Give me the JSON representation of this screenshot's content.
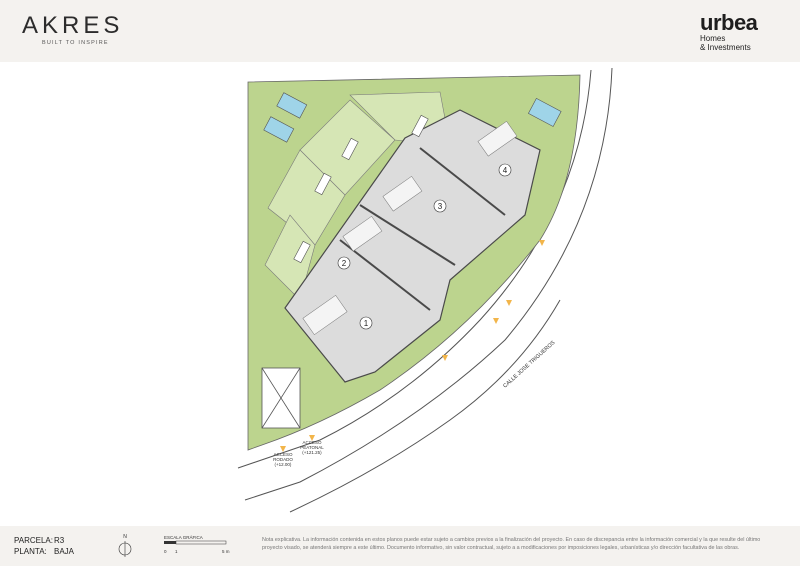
{
  "header": {
    "left_logo": "AKRES",
    "left_tagline": "BUILT TO INSPIRE",
    "right_logo": "urbea",
    "right_line1": "Homes",
    "right_line2": "& Investments"
  },
  "plan": {
    "unit_labels": [
      "1",
      "2",
      "3",
      "4"
    ],
    "street_label": "CALLE JOSE TRIGUEROS",
    "access_vehicle_line1": "ACCESO",
    "access_vehicle_line2": "RODADO",
    "access_vehicle_level": "(+12.00)",
    "access_pedestrian_line1": "ACCESO",
    "access_pedestrian_line2": "PEATONAL",
    "access_pedestrian_level": "(+121.25)"
  },
  "footer": {
    "parcela_label": "PARCELA:",
    "parcela_value": "R3",
    "planta_label": "PLANTA:",
    "planta_value": "BAJA",
    "north_label": "N",
    "scale_title": "ESCALA GRÁFICA",
    "scale_0": "0",
    "scale_1": "1",
    "scale_5": "5 m",
    "note": "Nota explicativa. La información contenida en estos planos puede estar sujeto a cambios previos a la finalización del proyecto. En caso de discrepancia entre la información comercial y la que resulte del último proyecto visado, se atenderá siempre a este último. Documento informativo, sin valor contractual, sujeto a a modificaciones por imposiciones legales, urbanísticas y/o dirección facultativa de las obras."
  },
  "colors": {
    "grass": "#bcd48e",
    "lawn": "#d6e6b5",
    "pool": "#9fd4e8",
    "wall": "#6a6a6a",
    "access_marker": "#f2b54a"
  }
}
